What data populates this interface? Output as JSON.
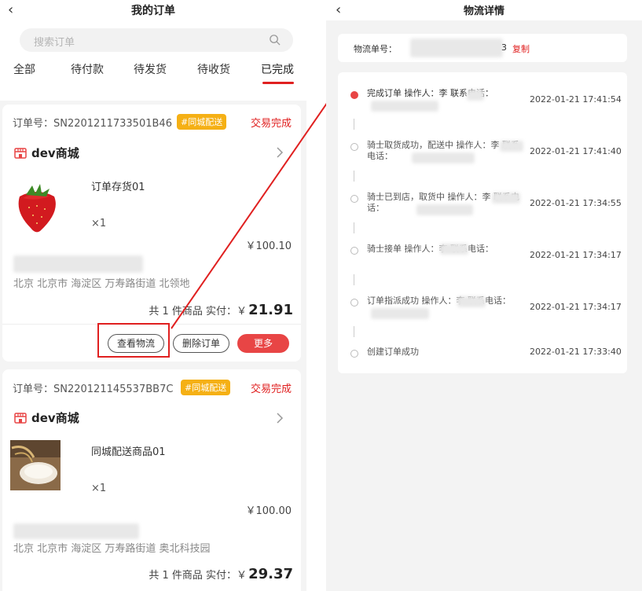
{
  "left": {
    "title": "我的订单",
    "search_placeholder": "搜索订单",
    "tabs": [
      "全部",
      "待付款",
      "待发货",
      "待收货",
      "已完成"
    ],
    "active_tab": "已完成",
    "orders": [
      {
        "order_label": "订单号：SN2201211733501B46",
        "tag": "#同城配送",
        "status": "交易完成",
        "shop": "dev商城",
        "product": "订单存货01",
        "qty": "×1",
        "price": "￥100.10",
        "address": "北京 北京市 海淀区 万寿路街道 北领地",
        "total_prefix": "共 1 件商品  实付：￥",
        "total_value": "21.91",
        "buttons": [
          "查看物流",
          "删除订单",
          "更多"
        ]
      },
      {
        "order_label": "订单号：SN220121145537BB7C",
        "tag": "#同城配送",
        "status": "交易完成",
        "shop": "dev商城",
        "product": "同城配送商品01",
        "qty": "×1",
        "price": "￥100.00",
        "address": "北京 北京市 海淀区 万寿路街道 奥北科技园",
        "total_prefix": "共 1 件商品  实付：￥",
        "total_value": "29.37"
      }
    ]
  },
  "right": {
    "title": "物流详情",
    "tracking_label": "物流单号：",
    "tracking_tail": "3",
    "copy_label": "复制",
    "events": [
      {
        "text": "完成订单 操作人：李   联系电话：",
        "time": "2022-01-21 17:41:54",
        "active": true
      },
      {
        "text": "骑士取货成功，配送中 操作人：李   联系电话：",
        "time": "2022-01-21 17:41:40",
        "active": false
      },
      {
        "text": "骑士已到店，取货中 操作人：李   联系电话：",
        "time": "2022-01-21 17:34:55",
        "active": false
      },
      {
        "text": "骑士接单 操作人：李   联系电话：",
        "time": "2022-01-21 17:34:17",
        "active": false
      },
      {
        "text": "订单指派成功 操作人：李   联系电话：",
        "time": "2022-01-21 17:34:17",
        "active": false
      },
      {
        "text": "创建订单成功",
        "time": "2022-01-21 17:33:40",
        "active": false
      }
    ]
  },
  "colors": {
    "accent": "#e02020",
    "tag": "#f5b015",
    "button_red": "#e84545"
  }
}
